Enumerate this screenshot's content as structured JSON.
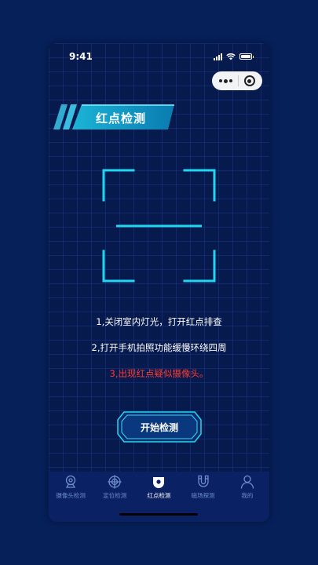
{
  "status_bar": {
    "time": "9:41"
  },
  "page": {
    "title": "红点检测"
  },
  "instructions": [
    "1,关闭室内灯光，打开红点排查",
    "2,打开手机拍照功能缓慢环绕四周"
  ],
  "warning": "3,出现红点疑似摄像头。",
  "start_button": {
    "label": "开始检测"
  },
  "tabs": [
    {
      "label": "摄像头检测",
      "icon": "camera-icon",
      "active": false
    },
    {
      "label": "定位检测",
      "icon": "crosshair-icon",
      "active": false
    },
    {
      "label": "红点检测",
      "icon": "red-dot-icon",
      "active": true
    },
    {
      "label": "磁场探测",
      "icon": "magnet-icon",
      "active": false
    },
    {
      "label": "我的",
      "icon": "user-icon",
      "active": false
    }
  ],
  "colors": {
    "accent": "#20d6f0",
    "warning": "#ff3b2f",
    "tab_inactive": "#6f8ec9"
  }
}
